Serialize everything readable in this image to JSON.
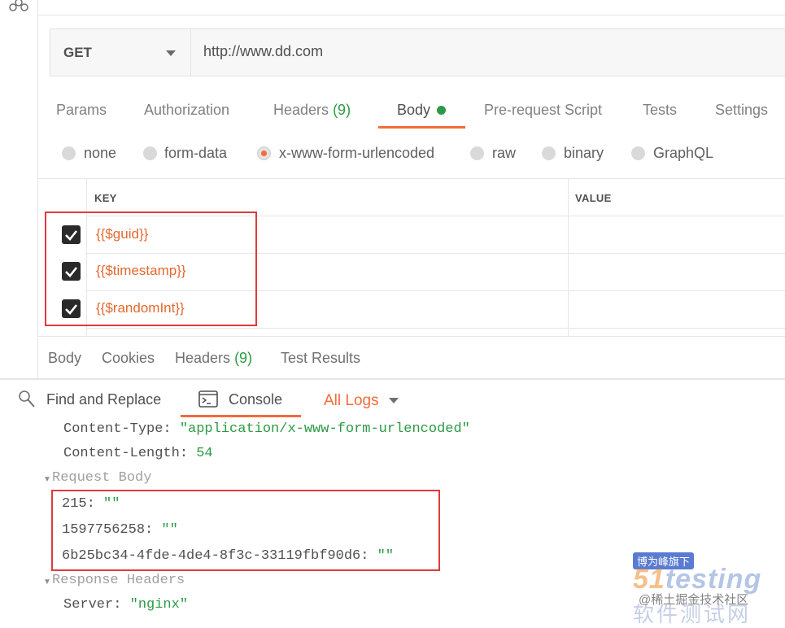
{
  "request": {
    "method": "GET",
    "url": "http://www.dd.com"
  },
  "request_tabs": [
    {
      "label": "Params"
    },
    {
      "label": "Authorization"
    },
    {
      "label": "Headers",
      "count": "(9)"
    },
    {
      "label": "Body",
      "active": true
    },
    {
      "label": "Pre-request Script"
    },
    {
      "label": "Tests"
    },
    {
      "label": "Settings"
    }
  ],
  "body_types": [
    {
      "label": "none"
    },
    {
      "label": "form-data"
    },
    {
      "label": "x-www-form-urlencoded",
      "selected": true
    },
    {
      "label": "raw"
    },
    {
      "label": "binary"
    },
    {
      "label": "GraphQL"
    }
  ],
  "table": {
    "key_header": "KEY",
    "value_header": "VALUE",
    "rows": [
      {
        "key": "{{$guid}}",
        "checked": true
      },
      {
        "key": "{{$timestamp}}",
        "checked": true
      },
      {
        "key": "{{$randomInt}}",
        "checked": true
      }
    ]
  },
  "response_tabs": [
    {
      "label": "Body"
    },
    {
      "label": "Cookies"
    },
    {
      "label": "Headers",
      "count": "(9)"
    },
    {
      "label": "Test Results"
    }
  ],
  "console_toolbar": {
    "find_replace": "Find and Replace",
    "console": "Console",
    "filter": "All Logs"
  },
  "console": {
    "headers": [
      {
        "key": "Content-Type:",
        "value": "\"application/x-www-form-urlencoded\""
      },
      {
        "key": "Content-Length:",
        "value": "54"
      }
    ],
    "request_body_label": "Request Body",
    "request_body": [
      {
        "key": "215:",
        "value": "\"\""
      },
      {
        "key": "1597756258:",
        "value": "\"\""
      },
      {
        "key": "6b25bc34-4fde-4de4-8f3c-33119fbf90d6:",
        "value": "\"\""
      }
    ],
    "response_headers_label": "Response Headers",
    "response_headers": [
      {
        "key": "Server:",
        "value": "\"nginx\""
      }
    ]
  },
  "watermark": {
    "tag": "博为峰旗下",
    "logo_prefix": "51",
    "logo": "testing",
    "sub": "软件测试网",
    "credit": "@稀土掘金技术社区"
  },
  "colors": {
    "accent": "#f26b3a",
    "success": "#2c9a44",
    "highlight_box": "#e03a3a"
  }
}
